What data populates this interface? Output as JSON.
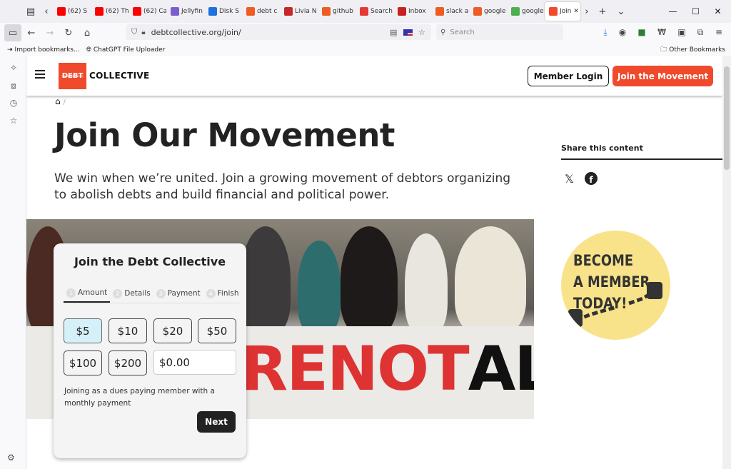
{
  "browser": {
    "tabs": [
      {
        "label": "(62) S",
        "color": "#ff0000"
      },
      {
        "label": "(62) Th",
        "color": "#ff0000"
      },
      {
        "label": "(62) Ca",
        "color": "#ff0000"
      },
      {
        "label": "Jellyfin",
        "color": "#7b5ccc"
      },
      {
        "label": "Disk S",
        "color": "#1e6fe0"
      },
      {
        "label": "debt c",
        "color": "#ef5b25"
      },
      {
        "label": "Livia N",
        "color": "#c62828"
      },
      {
        "label": "github",
        "color": "#ef5b25"
      },
      {
        "label": "Search",
        "color": "#e53935"
      },
      {
        "label": "Inbox",
        "color": "#c5221f"
      },
      {
        "label": "slack a",
        "color": "#ef5b25"
      },
      {
        "label": "google",
        "color": "#ef5b25"
      },
      {
        "label": "google",
        "color": "#4caf50"
      },
      {
        "label": "Join",
        "color": "#ef4a2c",
        "active": true
      }
    ],
    "url": "debtcollective.org/join/",
    "search_placeholder": "Search",
    "bookmarks": {
      "import": "Import bookmarks...",
      "chatgpt": "ChatGPT File Uploader",
      "other": "Other Bookmarks"
    }
  },
  "site": {
    "logo_mark": "DEBT",
    "logo_text": "COLLECTIVE",
    "login_label": "Member Login",
    "join_label": "Join the Movement"
  },
  "page": {
    "title": "Join Our Movement",
    "lead": "We win when we’re united. Join a growing movement of debtors organizing to abolish debts and build financial and political power.",
    "share_title": "Share this content"
  },
  "form": {
    "title": "Join the Debt Collective",
    "steps": [
      {
        "num": "1",
        "label": "Amount"
      },
      {
        "num": "2",
        "label": "Details"
      },
      {
        "num": "3",
        "label": "Payment"
      },
      {
        "num": "4",
        "label": "Finish"
      }
    ],
    "amounts": [
      "$5",
      "$10",
      "$20",
      "$50",
      "$100",
      "$200"
    ],
    "selected_amount": "$5",
    "custom_value": "$0.00",
    "note": "Joining as a dues paying member with a monthly payment",
    "next_label": "Next"
  },
  "hero_banner_text": {
    "red1": "RENOT",
    "black": "ALO"
  },
  "promo": {
    "line1": "BECOME",
    "line2": "A MEMBER",
    "line3": "TODAY!"
  },
  "colors": {
    "brand": "#ef4a2c",
    "selected": "#d6f0fa",
    "promo_bg": "#f8e38a"
  }
}
